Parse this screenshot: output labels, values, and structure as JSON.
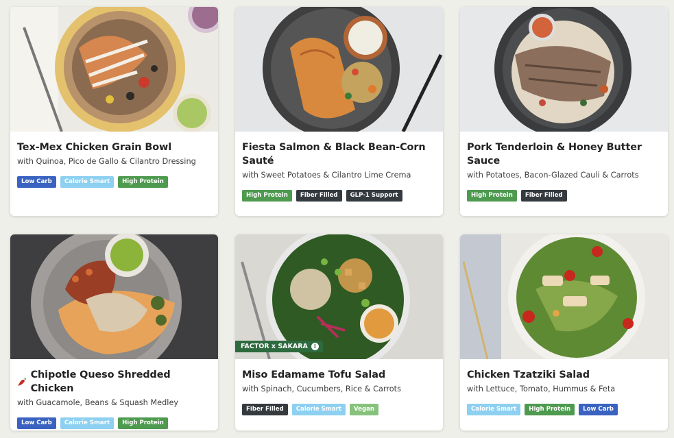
{
  "tag_colors": {
    "Low Carb": "#3a62c1",
    "Calorie Smart": "#8dd0f1",
    "High Protein": "#4e9a4f",
    "Fiber Filled": "#353a3f",
    "GLP-1 Support": "#353a3f",
    "Vegan": "#86c27b"
  },
  "meals": [
    {
      "title": "Tex-Mex Chicken Grain Bowl",
      "subtitle": "with Quinoa, Pico de Gallo & Cilantro Dressing",
      "tags": [
        "Low Carb",
        "Calorie Smart",
        "High Protein"
      ]
    },
    {
      "title": "Fiesta Salmon & Black Bean-Corn Sauté",
      "subtitle": "with Sweet Potatoes & Cilantro Lime Crema",
      "tags": [
        "High Protein",
        "Fiber Filled",
        "GLP-1 Support"
      ]
    },
    {
      "title": "Pork Tenderloin & Honey Butter Sauce",
      "subtitle": "with Potatoes, Bacon-Glazed Cauli & Carrots",
      "tags": [
        "High Protein",
        "Fiber Filled"
      ]
    },
    {
      "title": "Chipotle Queso Shredded Chicken",
      "title_icon": "chili-pepper-icon",
      "subtitle": "with Guacamole, Beans & Squash Medley",
      "tags": [
        "Low Carb",
        "Calorie Smart",
        "High Protein"
      ]
    },
    {
      "title": "Miso Edamame Tofu Salad",
      "subtitle": "with Spinach, Cucumbers, Rice & Carrots",
      "tags": [
        "Fiber Filled",
        "Calorie Smart",
        "Vegan"
      ],
      "badge": "FACTOR x SAKARA",
      "badge_icon": "info-icon"
    },
    {
      "title": "Chicken Tzatziki Salad",
      "subtitle": "with Lettuce, Tomato, Hummus & Feta",
      "tags": [
        "Calorie Smart",
        "High Protein",
        "Low Carb"
      ]
    }
  ]
}
